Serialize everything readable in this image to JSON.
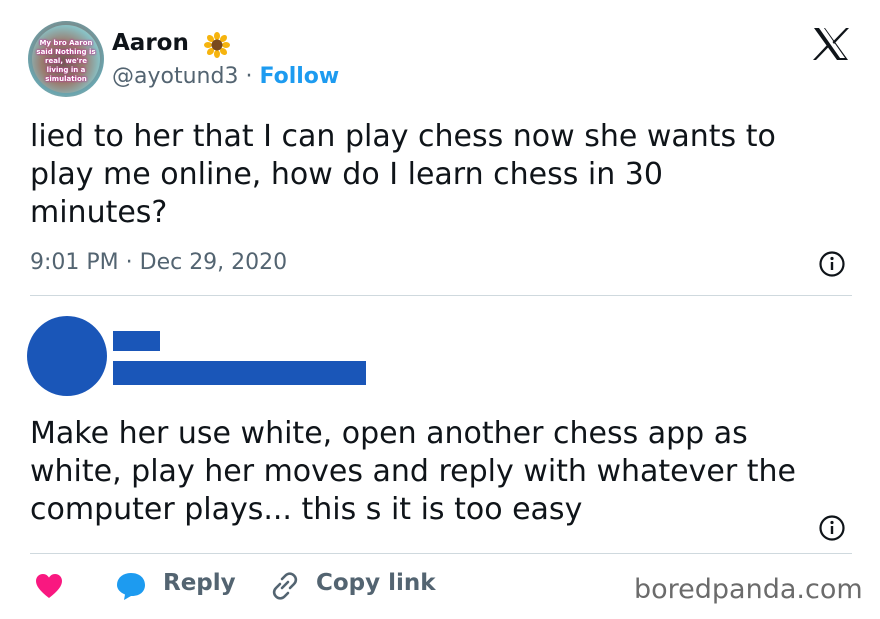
{
  "tweet": {
    "author": {
      "name": "Aaron",
      "name_emoji_icon": "sunflower-icon",
      "handle": "@ayotund3",
      "separator": "·",
      "follow_label": "Follow",
      "avatar_caption": "My bro Aaron said Nothing is real, we're living in a simulation"
    },
    "text": "lied to her that I can play chess now she wants to\nplay me online, how do I learn chess in 30\nminutes?",
    "timestamp": "9:01 PM · Dec 29, 2020",
    "platform_icon": "x-logo-icon"
  },
  "reply": {
    "author_redacted": true,
    "text": "Make her use white, open another chess app as\nwhite, play her moves and reply with whatever the\ncomputer plays... this s it is too easy"
  },
  "actions": {
    "like_icon": "heart-icon",
    "reply_icon": "speech-bubble-icon",
    "reply_label": "Reply",
    "copy_icon": "link-icon",
    "copy_label": "Copy link"
  },
  "watermark": "boredpanda.com",
  "colors": {
    "text": "#0f1419",
    "secondary": "#536471",
    "accent": "#1d9bf0",
    "heart": "#f91880",
    "redaction": "#1a56b8",
    "divider": "#cfd9de"
  }
}
